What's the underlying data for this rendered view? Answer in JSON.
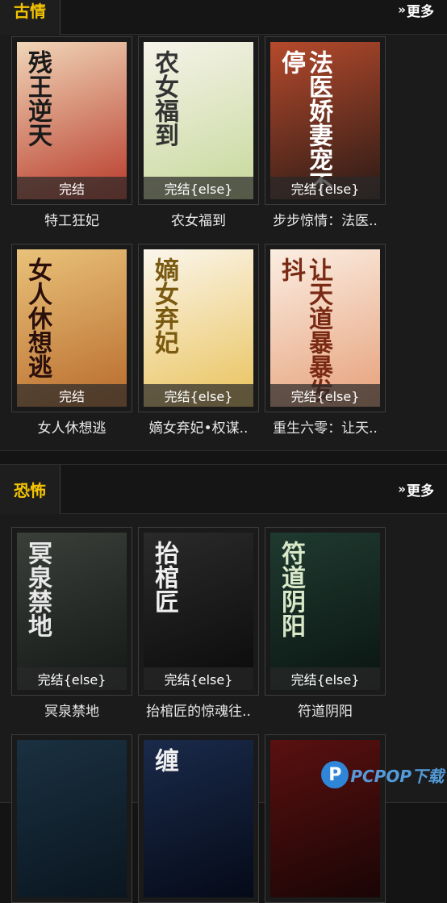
{
  "sections": [
    {
      "tab": "古情",
      "more": "更多",
      "books": [
        {
          "name": "特工狂妃",
          "status": "完结",
          "cover_title": "残王逆天",
          "cover_bg": [
            "#f0d6b8",
            "#b83a2a"
          ],
          "title_color": "#1a1a1a"
        },
        {
          "name": "农女福到",
          "status": "完结{else}",
          "cover_title": "农女福到",
          "cover_bg": [
            "#f6f3ea",
            "#c6d89a"
          ],
          "title_color": "#333333"
        },
        {
          "name": "步步惊情：法医..",
          "status": "完结{else}",
          "cover_title": "法医娇妻宠不停",
          "cover_bg": [
            "#b54a2c",
            "#2a1a16"
          ],
          "title_color": "#ffffff"
        },
        {
          "name": "女人休想逃",
          "status": "完结",
          "cover_title": "女人休想逃",
          "cover_bg": [
            "#e9c27a",
            "#b86a2c"
          ],
          "title_color": "#2a0f0a"
        },
        {
          "name": "嫡女弃妃•权谋..",
          "status": "完结{else}",
          "cover_title": "嫡女弃妃",
          "cover_bg": [
            "#fbf6ec",
            "#e9c25a"
          ],
          "title_color": "#7a5a10"
        },
        {
          "name": "重生六零：让天..",
          "status": "完结{else}",
          "cover_title": "让天道暴暴发抖",
          "cover_bg": [
            "#fbeee2",
            "#e6a07a"
          ],
          "title_color": "#7a2a14"
        }
      ]
    },
    {
      "tab": "恐怖",
      "more": "更多",
      "books": [
        {
          "name": "冥泉禁地",
          "status": "完结{else}",
          "cover_title": "冥泉禁地",
          "cover_bg": [
            "#3a3f3a",
            "#141816"
          ],
          "title_color": "#e8e8e8"
        },
        {
          "name": "抬棺匠的惊魂往..",
          "status": "完结{else}",
          "cover_title": "抬棺匠",
          "cover_bg": [
            "#2a2a2a",
            "#0a0a0a"
          ],
          "title_color": "#f0f0f0"
        },
        {
          "name": "符道阴阳",
          "status": "完结{else}",
          "cover_title": "符道阴阳",
          "cover_bg": [
            "#1f3a30",
            "#0a1410"
          ],
          "title_color": "#d8e8c8"
        },
        {
          "name": "",
          "status": "",
          "cover_title": "",
          "cover_bg": [
            "#1a3040",
            "#0a1620"
          ],
          "title_color": "#cccccc"
        },
        {
          "name": "",
          "status": "",
          "cover_title": "缠",
          "cover_bg": [
            "#1a2a4a",
            "#050a18"
          ],
          "title_color": "#f0f0f0"
        },
        {
          "name": "",
          "status": "",
          "cover_title": "",
          "cover_bg": [
            "#5a1010",
            "#1a0505"
          ],
          "title_color": "#ffffff"
        }
      ]
    }
  ],
  "watermark": {
    "logo": "P",
    "text": "PCPOP下载"
  }
}
